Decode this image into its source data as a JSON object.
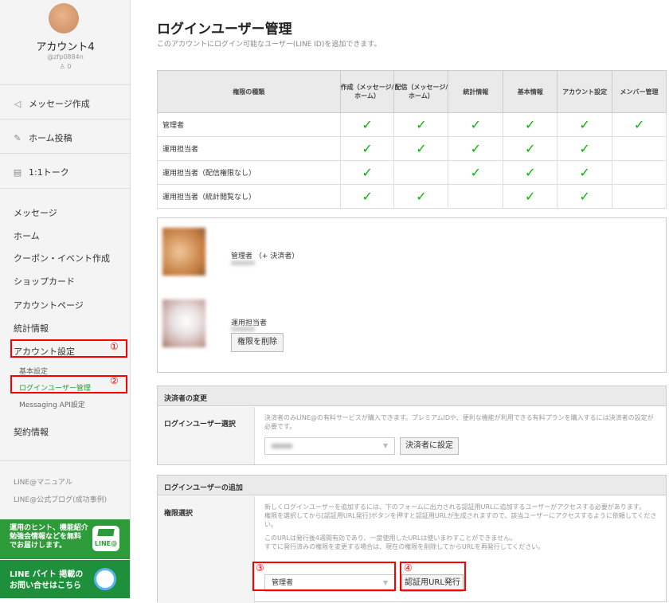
{
  "sidebar": {
    "account_name": "アカウント4",
    "account_id": "@zfp0884n",
    "followers": "0",
    "actions": [
      {
        "icon": "speaker-icon",
        "label": "メッセージ作成"
      },
      {
        "icon": "edit-icon",
        "label": "ホーム投稿"
      },
      {
        "icon": "chat-icon",
        "label": "1:1トーク"
      }
    ],
    "nav": [
      "メッセージ",
      "ホーム",
      "クーポン・イベント作成",
      "ショップカード",
      "アカウントページ",
      "統計情報",
      "アカウント設定"
    ],
    "sub": [
      "基本設定",
      "ログインユーザー管理",
      "Messaging API設定"
    ],
    "contract": "契約情報",
    "footer_links": [
      "LINE@マニュアル",
      "LINE@公式ブログ(成功事例)"
    ],
    "banner1": {
      "line1": "運用のヒント、機能紹介",
      "line2": "勉強会情報などを無料",
      "line3": "でお届けします。",
      "badge": "LINE@"
    },
    "banner2": {
      "line1": "LINE バイト 掲載の",
      "line2": "お問い合せはこちら"
    }
  },
  "annotations": [
    "①",
    "②",
    "③",
    "④"
  ],
  "main": {
    "title": "ログインユーザー管理",
    "subtitle": "このアカウントにログイン可能なユーザー(LINE ID)を追加できます。",
    "table": {
      "headers": [
        "権限の種類",
        "作成（メッセージ/ホーム）",
        "配信（メッセージ/ホーム）",
        "統計情報",
        "基本情報",
        "アカウント設定",
        "メンバー管理"
      ],
      "rows": [
        {
          "role": "管理者",
          "checks": [
            true,
            true,
            true,
            true,
            true,
            true
          ]
        },
        {
          "role": "運用担当者",
          "checks": [
            true,
            true,
            true,
            true,
            true,
            false
          ]
        },
        {
          "role": "運用担当者（配信権限なし）",
          "checks": [
            true,
            false,
            true,
            true,
            true,
            false
          ]
        },
        {
          "role": "運用担当者（統計閲覧なし）",
          "checks": [
            true,
            true,
            false,
            true,
            true,
            false
          ]
        }
      ]
    },
    "users": [
      {
        "role": "管理者 （+ 決済者）"
      },
      {
        "role": "運用担当者",
        "remove_button": "権限を削除"
      }
    ],
    "payer": {
      "heading": "決済者の変更",
      "label": "ログインユーザー選択",
      "note": "決済者のみLINE@の有料サービスが購入できます。プレミアムIDや、便利な機能が利用できる有料プランを購入するには決済者の設定が必要です。",
      "button": "決済者に設定"
    },
    "add": {
      "heading": "ログインユーザーの追加",
      "label": "権限選択",
      "note1": "新しくログインユーザーを追加するには、下のフォームに出力される認証用URLに追加するユーザーがアクセスする必要があります。",
      "note2": "権限を選択してから[認証用URL発行]ボタンを押すと認証用URLが生成されますので、該当ユーザーにアクセスするように依頼してください。",
      "note3": "このURLは発行後4週間有効であり、一度使用したURLは使いまわすことができません。",
      "note4": "すでに発行済みの権限を変更する場合は、現在の権限を削除してからURLを再発行してください。",
      "select_value": "管理者",
      "button": "認証用URL発行"
    }
  }
}
